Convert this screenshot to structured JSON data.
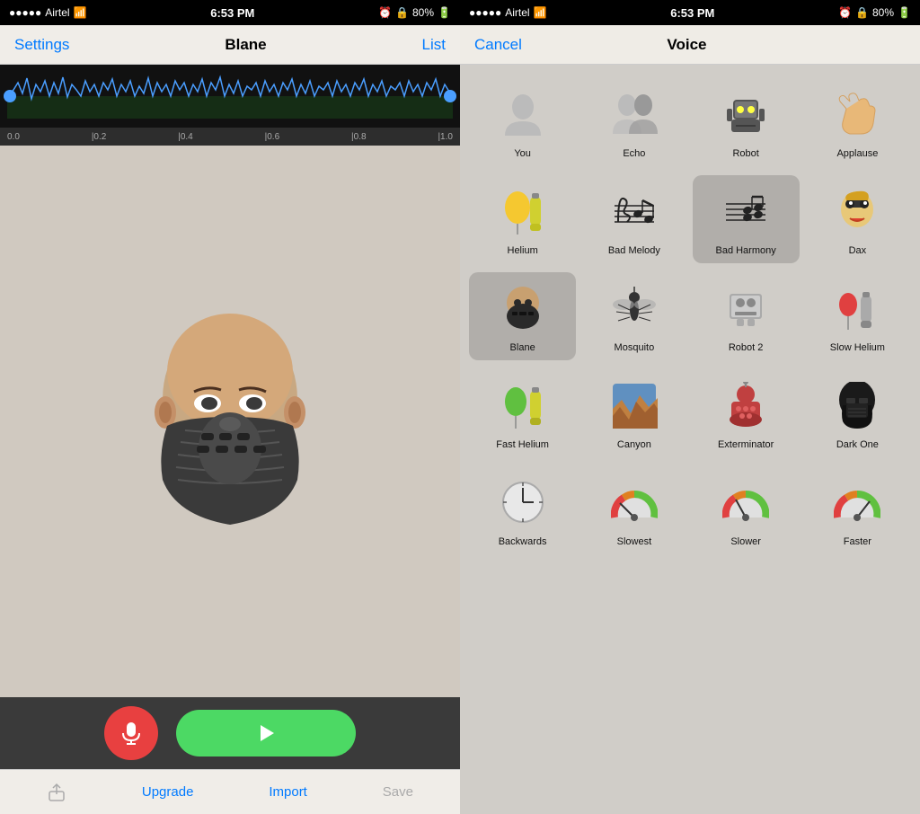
{
  "left": {
    "statusBar": {
      "carrier": "Airtel",
      "time": "6:53 PM",
      "battery": "80%"
    },
    "navBar": {
      "settings": "Settings",
      "title": "Blane",
      "list": "List"
    },
    "waveform": {
      "labels": [
        "0.0",
        "|0.2",
        "|0.4",
        "|0.6",
        "|0.8",
        "|1.0"
      ]
    },
    "bottomToolbar": {
      "upgrade": "Upgrade",
      "import": "Import",
      "save": "Save"
    }
  },
  "right": {
    "statusBar": {
      "carrier": "Airtel",
      "time": "6:53 PM",
      "battery": "80%"
    },
    "navBar": {
      "cancel": "Cancel",
      "title": "Voice"
    },
    "voices": [
      {
        "id": "you",
        "label": "You",
        "emoji": "👤",
        "type": "person"
      },
      {
        "id": "echo",
        "label": "Echo",
        "emoji": "👥",
        "type": "persons"
      },
      {
        "id": "robot",
        "label": "Robot",
        "emoji": "🤖",
        "type": "robot"
      },
      {
        "id": "applause",
        "label": "Applause",
        "emoji": "👏",
        "type": "hands"
      },
      {
        "id": "helium",
        "label": "Helium",
        "emoji": "🎈",
        "type": "balloon"
      },
      {
        "id": "bad-melody",
        "label": "Bad Melody",
        "emoji": "🎵",
        "type": "notes"
      },
      {
        "id": "bad-harmony",
        "label": "Bad Harmony",
        "emoji": "🎼",
        "type": "notes2"
      },
      {
        "id": "dax",
        "label": "Dax",
        "emoji": "😎",
        "type": "face"
      },
      {
        "id": "blane",
        "label": "Blane",
        "emoji": "🦹",
        "type": "mask",
        "selected": true
      },
      {
        "id": "mosquito",
        "label": "Mosquito",
        "emoji": "🦟",
        "type": "bug"
      },
      {
        "id": "robot2",
        "label": "Robot 2",
        "emoji": "🖨",
        "type": "printer"
      },
      {
        "id": "slow-helium",
        "label": "Slow Helium",
        "emoji": "🎈",
        "type": "balloon-s"
      },
      {
        "id": "fast-helium",
        "label": "Fast Helium",
        "emoji": "🎈",
        "type": "balloon-f"
      },
      {
        "id": "canyon",
        "label": "Canyon",
        "emoji": "🏔",
        "type": "canyon"
      },
      {
        "id": "exterminator",
        "label": "Exterminator",
        "emoji": "🔴",
        "type": "dalek"
      },
      {
        "id": "dark-one",
        "label": "Dark One",
        "emoji": "🪖",
        "type": "vader"
      },
      {
        "id": "backwards",
        "label": "Backwards",
        "emoji": "🕐",
        "type": "clock"
      },
      {
        "id": "slowest",
        "label": "Slowest",
        "emoji": "🟡",
        "type": "speed"
      },
      {
        "id": "slower",
        "label": "Slower",
        "emoji": "🟢",
        "type": "speed"
      },
      {
        "id": "faster",
        "label": "Faster",
        "emoji": "🔴",
        "type": "speed"
      }
    ]
  }
}
